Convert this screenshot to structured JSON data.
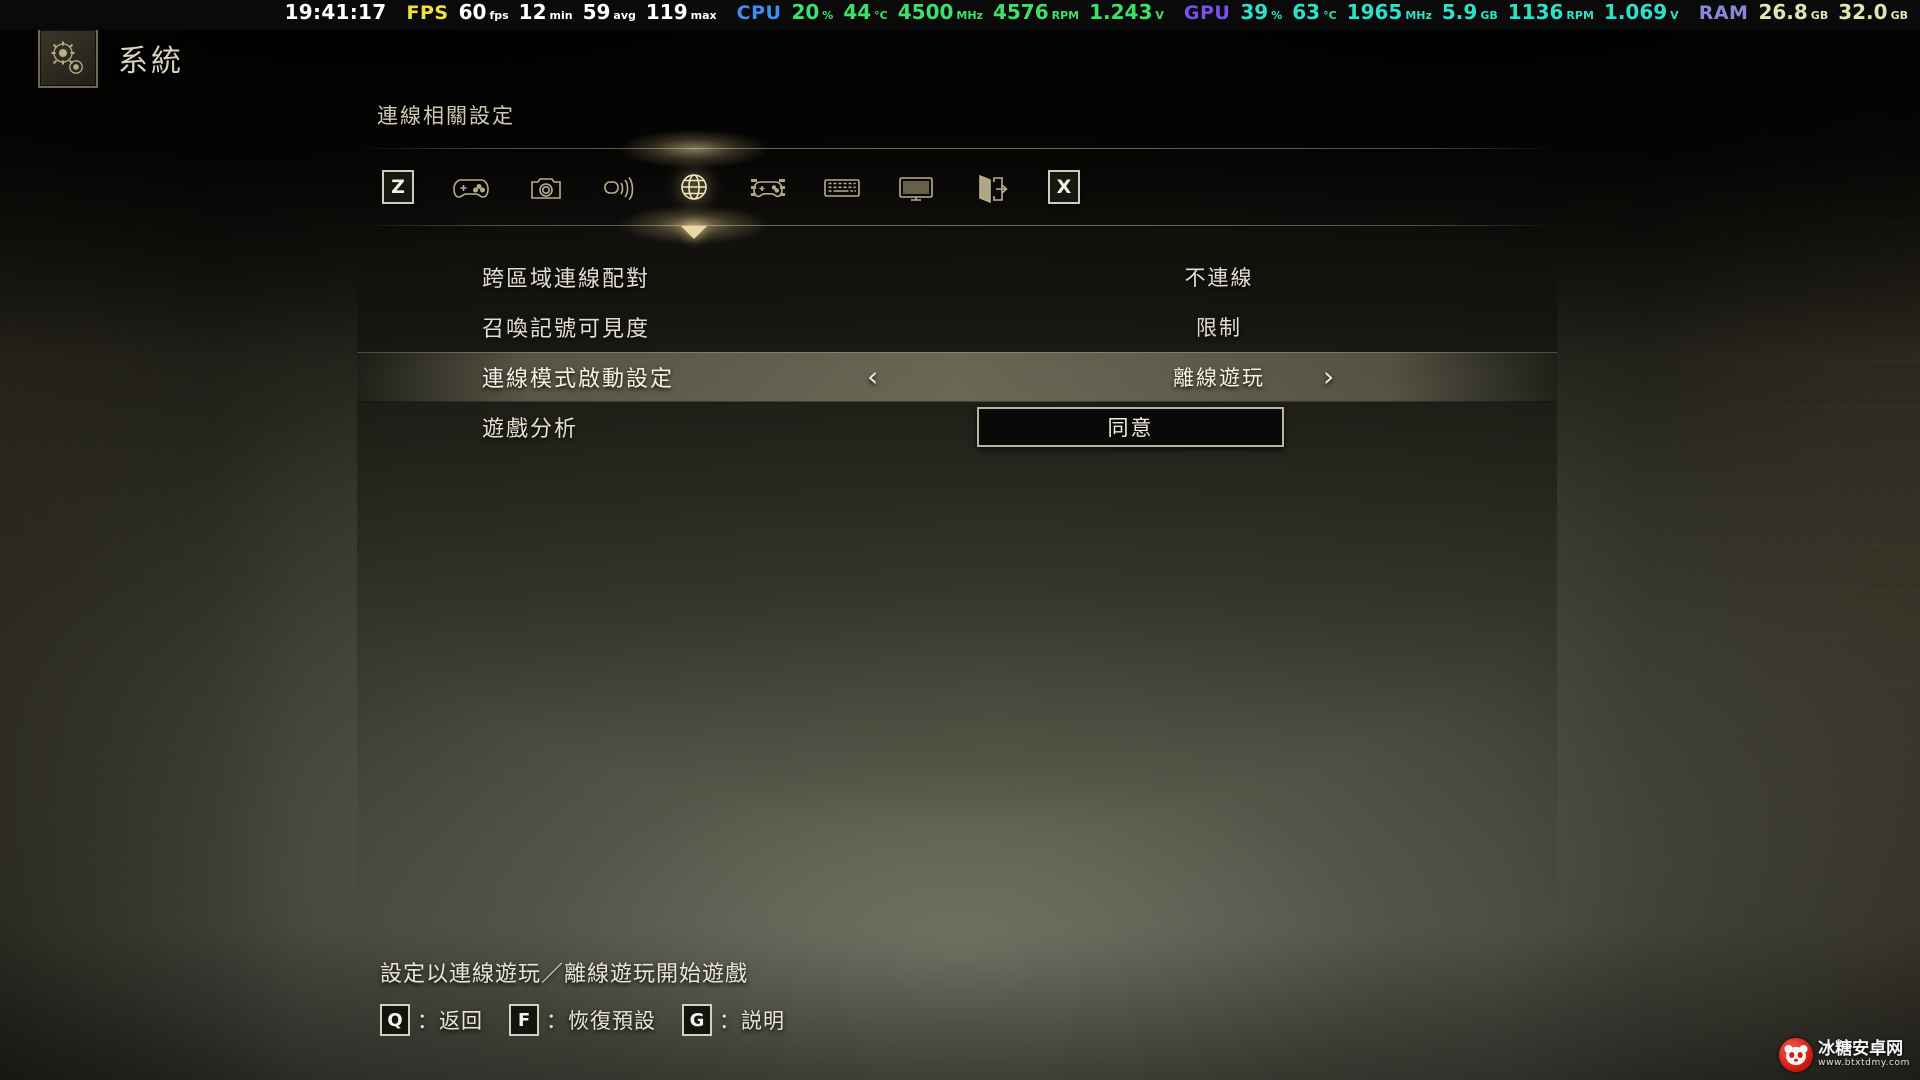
{
  "hud": {
    "clock": "19:41:17",
    "groups": [
      {
        "label": "FPS",
        "label_color": "#f2e33a",
        "items": [
          {
            "value": "60",
            "unit": "fps",
            "color": "#ffffff"
          },
          {
            "value": "12",
            "unit": "min",
            "color": "#ffffff"
          },
          {
            "value": "59",
            "unit": "avg",
            "color": "#ffffff"
          },
          {
            "value": "119",
            "unit": "max",
            "color": "#ffffff"
          }
        ]
      },
      {
        "label": "CPU",
        "label_color": "#3c8ef0",
        "items": [
          {
            "value": "20",
            "unit": "%",
            "color": "#3ee06a"
          },
          {
            "value": "44",
            "unit": "°C",
            "color": "#3ee06a"
          },
          {
            "value": "4500",
            "unit": "MHz",
            "color": "#3ee06a"
          },
          {
            "value": "4576",
            "unit": "RPM",
            "color": "#3ee06a"
          },
          {
            "value": "1.243",
            "unit": "V",
            "color": "#3ee06a"
          }
        ]
      },
      {
        "label": "GPU",
        "label_color": "#7a4ef0",
        "items": [
          {
            "value": "39",
            "unit": "%",
            "color": "#2fe0c8"
          },
          {
            "value": "63",
            "unit": "°C",
            "color": "#2fe0c8"
          },
          {
            "value": "1965",
            "unit": "MHz",
            "color": "#2fe0c8"
          },
          {
            "value": "5.9",
            "unit": "GB",
            "color": "#2fe0c8"
          },
          {
            "value": "1136",
            "unit": "RPM",
            "color": "#2fe0c8"
          },
          {
            "value": "1.069",
            "unit": "V",
            "color": "#2fe0c8"
          }
        ]
      },
      {
        "label": "RAM",
        "label_color": "#8a86d8",
        "items": [
          {
            "value": "26.8",
            "unit": "GB",
            "color": "#d8e8b0"
          },
          {
            "value": "32.0",
            "unit": "GB",
            "color": "#d8e8b0"
          }
        ]
      }
    ]
  },
  "header": {
    "title": "系統",
    "plate_icon": "gears-icon"
  },
  "panel": {
    "section_title": "連線相關設定"
  },
  "tabs": [
    {
      "id": "tab-keybind",
      "icon": "keycap-z-icon",
      "label": "Z",
      "active": false
    },
    {
      "id": "tab-gamepad",
      "icon": "gamepad-icon",
      "label": "手把設定",
      "active": false
    },
    {
      "id": "tab-camera",
      "icon": "camera-icon",
      "label": "鏡頭設定",
      "active": false
    },
    {
      "id": "tab-audio",
      "icon": "sound-icon",
      "label": "聲音設定",
      "active": false
    },
    {
      "id": "tab-network",
      "icon": "globe-icon",
      "label": "連線相關設定",
      "active": true
    },
    {
      "id": "tab-controller",
      "icon": "controller-map-icon",
      "label": "手把操作設定",
      "active": false
    },
    {
      "id": "tab-keyboard",
      "icon": "keyboard-icon",
      "label": "鍵盤滑鼠設定",
      "active": false
    },
    {
      "id": "tab-display",
      "icon": "monitor-icon",
      "label": "畫面設定",
      "active": false
    },
    {
      "id": "tab-exit",
      "icon": "exit-door-icon",
      "label": "離開遊戲",
      "active": false
    },
    {
      "id": "tab-close",
      "icon": "keycap-x-icon",
      "label": "X",
      "active": false
    }
  ],
  "settings": [
    {
      "id": "cross-region-matchmaking",
      "label": "跨區域連線配對",
      "value": "不連線",
      "type": "text",
      "selected": false,
      "arrows": false
    },
    {
      "id": "summon-sign-visibility",
      "label": "召喚記號可見度",
      "value": "限制",
      "type": "text",
      "selected": false,
      "arrows": false
    },
    {
      "id": "launch-mode",
      "label": "連線模式啟動設定",
      "value": "離線遊玩",
      "type": "stepper",
      "selected": true,
      "arrows": true,
      "arrow_left": "‹",
      "arrow_right": "›"
    },
    {
      "id": "game-analytics",
      "label": "遊戲分析",
      "value": "同意",
      "type": "button",
      "selected": false,
      "arrows": false
    }
  ],
  "footer": {
    "hint": "設定以連線遊玩／離線遊玩開始遊戲",
    "keys": [
      {
        "key": "Q",
        "action": "：返回"
      },
      {
        "key": "F",
        "action": "：恢復預設"
      },
      {
        "key": "G",
        "action": "：説明"
      }
    ]
  },
  "watermark": {
    "main": "冰糖安卓网",
    "sub": "www.btxtdmy.com",
    "logo_icon": "panda-logo-icon"
  },
  "colors": {
    "accent_gold": "#e8d9a4",
    "panel_text": "#e3ded0",
    "highlight_row": "#b0aa8c",
    "hud_bg": "#0a0a0a"
  }
}
